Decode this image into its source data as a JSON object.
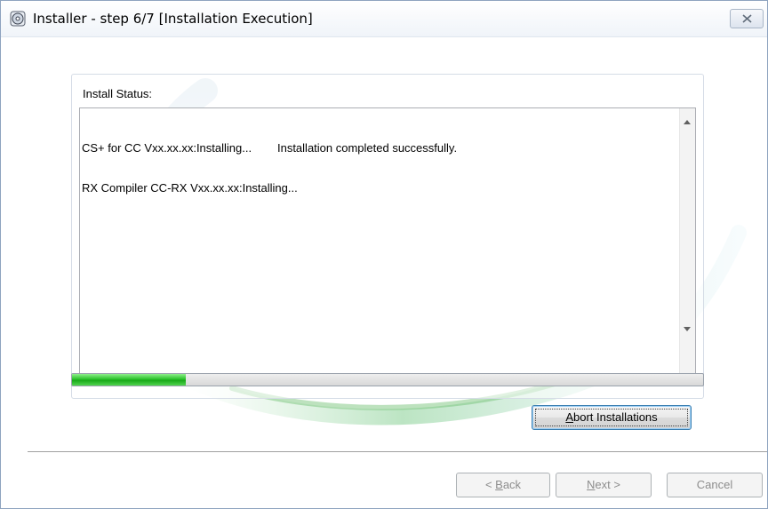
{
  "window": {
    "title": "Installer - step 6/7 [Installation Execution]",
    "icon": "installer-disc-icon",
    "close_icon": "close-icon"
  },
  "status": {
    "label": "Install Status:",
    "log": [
      "CS+ for CC Vxx.xx.xx:Installing...        Installation completed successfully.",
      "RX Compiler CC-RX Vxx.xx.xx:Installing..."
    ]
  },
  "progress": {
    "percent": 18,
    "color": "#2bc22b"
  },
  "buttons": {
    "abort": {
      "mnemonic": "A",
      "rest": "bort Installations"
    },
    "back": {
      "prefix": "< ",
      "mnemonic": "B",
      "rest": "ack"
    },
    "next": {
      "mnemonic": "N",
      "rest": "ext >"
    },
    "cancel": "Cancel"
  }
}
